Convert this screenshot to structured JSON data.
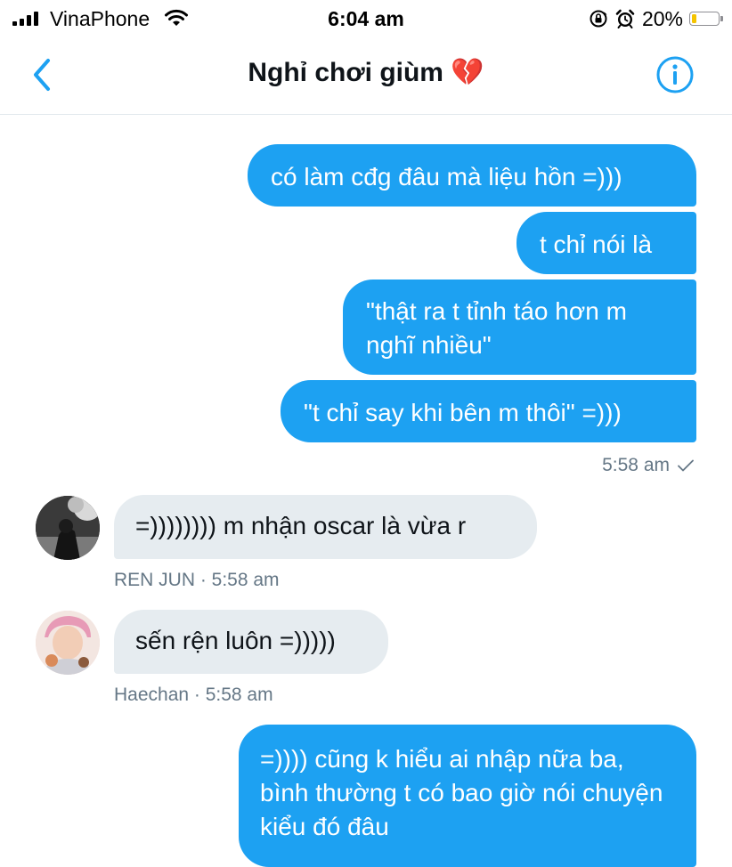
{
  "status_bar": {
    "carrier": "VinaPhone",
    "time": "6:04 am",
    "battery_percent": "20%",
    "battery_level": 0.2,
    "battery_color": "#f5c400",
    "icons": [
      "signal-icon",
      "wifi-icon",
      "orientation-lock-icon",
      "alarm-icon",
      "battery-icon"
    ]
  },
  "header": {
    "title": "Nghỉ chơi giùm 💔",
    "back_icon": "chevron-left-icon",
    "info_icon": "info-icon"
  },
  "colors": {
    "accent": "#1da1f2",
    "received_bubble": "#e6ecf0",
    "meta_text": "#657786"
  },
  "messages": [
    {
      "direction": "sent",
      "text": "có làm cđg đâu mà liệu hồn =)))"
    },
    {
      "direction": "sent",
      "text": "t chỉ nói là"
    },
    {
      "direction": "sent",
      "text": "\"thật ra t tỉnh táo hơn m nghĩ nhiều\""
    },
    {
      "direction": "sent",
      "text": "\"t chỉ say khi bên m thôi\" =)))"
    },
    {
      "direction": "sent",
      "meta": "5:58 am",
      "status_icon": "checkmark-icon"
    },
    {
      "direction": "received",
      "sender": "REN JUN",
      "text": "=)))))))) m nhận oscar là vừa r",
      "meta": "REN JUN · 5:58 am"
    },
    {
      "direction": "received",
      "sender": "Haechan",
      "text": "sến rện luôn =)))))",
      "meta": "Haechan · 5:58 am"
    },
    {
      "direction": "sent",
      "text": "=)))) cũng k hiểu ai nhập nữa ba, bình thường t có bao giờ nói chuyện kiểu đó đâu"
    }
  ]
}
